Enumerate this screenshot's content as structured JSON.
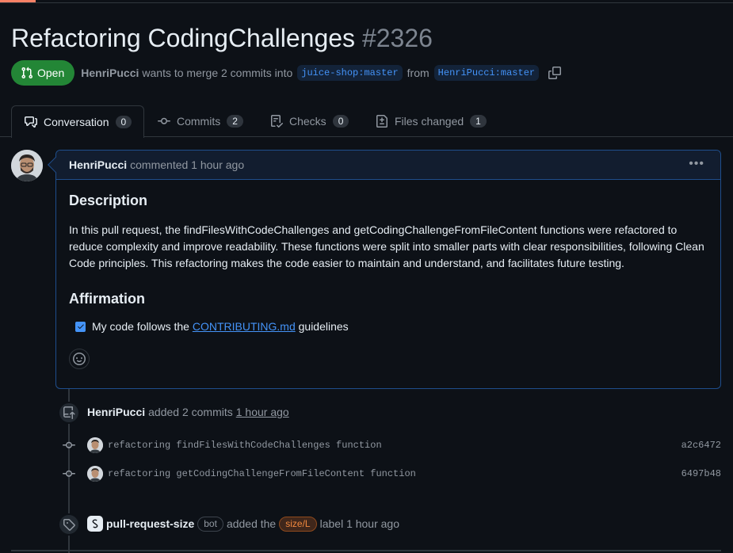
{
  "pr": {
    "title": "Refactoring CodingChallenges",
    "number": "#2326",
    "state": "Open",
    "author": "HenriPucci",
    "merge_text": "wants to merge 2 commits into",
    "base_branch": "juice-shop:master",
    "from_text": "from",
    "head_branch": "HenriPucci:master"
  },
  "tabs": [
    {
      "label": "Conversation",
      "count": "0",
      "icon": "conversation-icon"
    },
    {
      "label": "Commits",
      "count": "2",
      "icon": "commit-icon"
    },
    {
      "label": "Checks",
      "count": "0",
      "icon": "checklist-icon"
    },
    {
      "label": "Files changed",
      "count": "1",
      "icon": "file-diff-icon"
    }
  ],
  "comment": {
    "author": "HenriPucci",
    "action": "commented 1 hour ago",
    "heading1": "Description",
    "paragraph": "In this pull request, the findFilesWithCodeChallenges and getCodingChallengeFromFileContent functions were refactored to reduce complexity and improve readability. These functions were split into smaller parts with clear responsibilities, following Clean Code principles. This refactoring makes the code easier to maintain and understand, and facilitates future testing.",
    "heading2": "Affirmation",
    "task_prefix": "My code follows the",
    "task_link": "CONTRIBUTING.md",
    "task_suffix": "guidelines",
    "task_checked": true
  },
  "timeline": {
    "commits_event": {
      "author": "HenriPucci",
      "action": "added 2 commits",
      "time": "1 hour ago"
    },
    "commits": [
      {
        "message": "refactoring findFilesWithCodeChallenges function",
        "sha": "a2c6472"
      },
      {
        "message": "refactoring getCodingChallengeFromFileContent function",
        "sha": "6497b48"
      }
    ],
    "label_event": {
      "author": "pull-request-size",
      "bot": "bot",
      "action": "added the",
      "label": "size/L",
      "suffix": "label 1 hour ago"
    }
  },
  "colors": {
    "open": "#238636",
    "link": "#4493f8",
    "label_size": "#f0883e"
  }
}
